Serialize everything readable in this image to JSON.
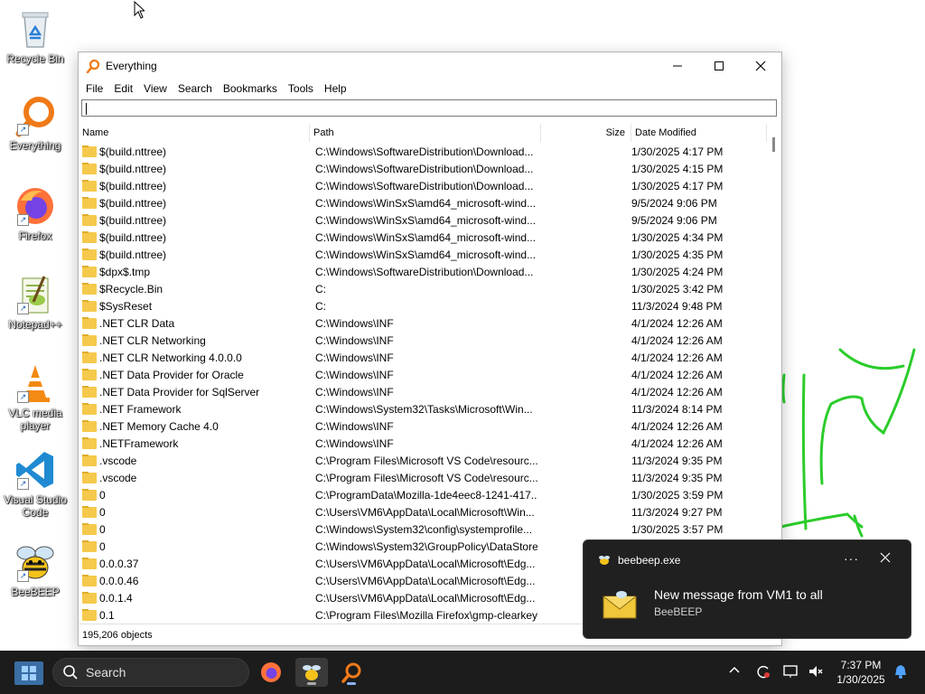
{
  "desktop": {
    "icons": [
      {
        "label": "Recycle Bin"
      },
      {
        "label": "Everything"
      },
      {
        "label": "Firefox"
      },
      {
        "label": "Notepad++"
      },
      {
        "label": "VLC media player"
      },
      {
        "label": "Visual Studio Code"
      },
      {
        "label": "BeeBEEP"
      }
    ]
  },
  "window": {
    "title": "Everything",
    "menu": [
      "File",
      "Edit",
      "View",
      "Search",
      "Bookmarks",
      "Tools",
      "Help"
    ],
    "search": {
      "value": ""
    },
    "columns": {
      "name": "Name",
      "path": "Path",
      "size": "Size",
      "date": "Date Modified"
    },
    "rows": [
      {
        "name": "$(build.nttree)",
        "path": "C:\\Windows\\SoftwareDistribution\\Download...",
        "date": "1/30/2025 4:17 PM"
      },
      {
        "name": "$(build.nttree)",
        "path": "C:\\Windows\\SoftwareDistribution\\Download...",
        "date": "1/30/2025 4:15 PM"
      },
      {
        "name": "$(build.nttree)",
        "path": "C:\\Windows\\SoftwareDistribution\\Download...",
        "date": "1/30/2025 4:17 PM"
      },
      {
        "name": "$(build.nttree)",
        "path": "C:\\Windows\\WinSxS\\amd64_microsoft-wind...",
        "date": "9/5/2024 9:06 PM"
      },
      {
        "name": "$(build.nttree)",
        "path": "C:\\Windows\\WinSxS\\amd64_microsoft-wind...",
        "date": "9/5/2024 9:06 PM"
      },
      {
        "name": "$(build.nttree)",
        "path": "C:\\Windows\\WinSxS\\amd64_microsoft-wind...",
        "date": "1/30/2025 4:34 PM"
      },
      {
        "name": "$(build.nttree)",
        "path": "C:\\Windows\\WinSxS\\amd64_microsoft-wind...",
        "date": "1/30/2025 4:35 PM"
      },
      {
        "name": "$dpx$.tmp",
        "path": "C:\\Windows\\SoftwareDistribution\\Download...",
        "date": "1/30/2025 4:24 PM"
      },
      {
        "name": "$Recycle.Bin",
        "path": "C:",
        "date": "1/30/2025 3:42 PM"
      },
      {
        "name": "$SysReset",
        "path": "C:",
        "date": "11/3/2024 9:48 PM"
      },
      {
        "name": ".NET CLR Data",
        "path": "C:\\Windows\\INF",
        "date": "4/1/2024 12:26 AM"
      },
      {
        "name": ".NET CLR Networking",
        "path": "C:\\Windows\\INF",
        "date": "4/1/2024 12:26 AM"
      },
      {
        "name": ".NET CLR Networking 4.0.0.0",
        "path": "C:\\Windows\\INF",
        "date": "4/1/2024 12:26 AM"
      },
      {
        "name": ".NET Data Provider for Oracle",
        "path": "C:\\Windows\\INF",
        "date": "4/1/2024 12:26 AM"
      },
      {
        "name": ".NET Data Provider for SqlServer",
        "path": "C:\\Windows\\INF",
        "date": "4/1/2024 12:26 AM"
      },
      {
        "name": ".NET Framework",
        "path": "C:\\Windows\\System32\\Tasks\\Microsoft\\Win...",
        "date": "11/3/2024 8:14 PM"
      },
      {
        "name": ".NET Memory Cache 4.0",
        "path": "C:\\Windows\\INF",
        "date": "4/1/2024 12:26 AM"
      },
      {
        "name": ".NETFramework",
        "path": "C:\\Windows\\INF",
        "date": "4/1/2024 12:26 AM"
      },
      {
        "name": ".vscode",
        "path": "C:\\Program Files\\Microsoft VS Code\\resourc...",
        "date": "11/3/2024 9:35 PM"
      },
      {
        "name": ".vscode",
        "path": "C:\\Program Files\\Microsoft VS Code\\resourc...",
        "date": "11/3/2024 9:35 PM"
      },
      {
        "name": "0",
        "path": "C:\\ProgramData\\Mozilla-1de4eec8-1241-417...",
        "date": "1/30/2025 3:59 PM"
      },
      {
        "name": "0",
        "path": "C:\\Users\\VM6\\AppData\\Local\\Microsoft\\Win...",
        "date": "11/3/2024 9:27 PM"
      },
      {
        "name": "0",
        "path": "C:\\Windows\\System32\\config\\systemprofile...",
        "date": "1/30/2025 3:57 PM"
      },
      {
        "name": "0",
        "path": "C:\\Windows\\System32\\GroupPolicy\\DataStore",
        "date": ""
      },
      {
        "name": "0.0.0.37",
        "path": "C:\\Users\\VM6\\AppData\\Local\\Microsoft\\Edg...",
        "date": ""
      },
      {
        "name": "0.0.0.46",
        "path": "C:\\Users\\VM6\\AppData\\Local\\Microsoft\\Edg...",
        "date": ""
      },
      {
        "name": "0.0.1.4",
        "path": "C:\\Users\\VM6\\AppData\\Local\\Microsoft\\Edg...",
        "date": ""
      },
      {
        "name": "0.1",
        "path": "C:\\Program Files\\Mozilla Firefox\\gmp-clearkey",
        "date": ""
      }
    ],
    "status": "195,206 objects"
  },
  "notification": {
    "app": "beebeep.exe",
    "more": "···",
    "title": "New message from VM1 to all",
    "subtitle": "BeeBEEP"
  },
  "taskbar": {
    "search_label": "Search",
    "time": "7:37 PM",
    "date": "1/30/2025"
  },
  "icons": {
    "start": "windows-start-icon",
    "search": "magnifier-icon",
    "minimize": "minimize-icon",
    "maximize": "maximize-icon",
    "close": "close-icon"
  }
}
